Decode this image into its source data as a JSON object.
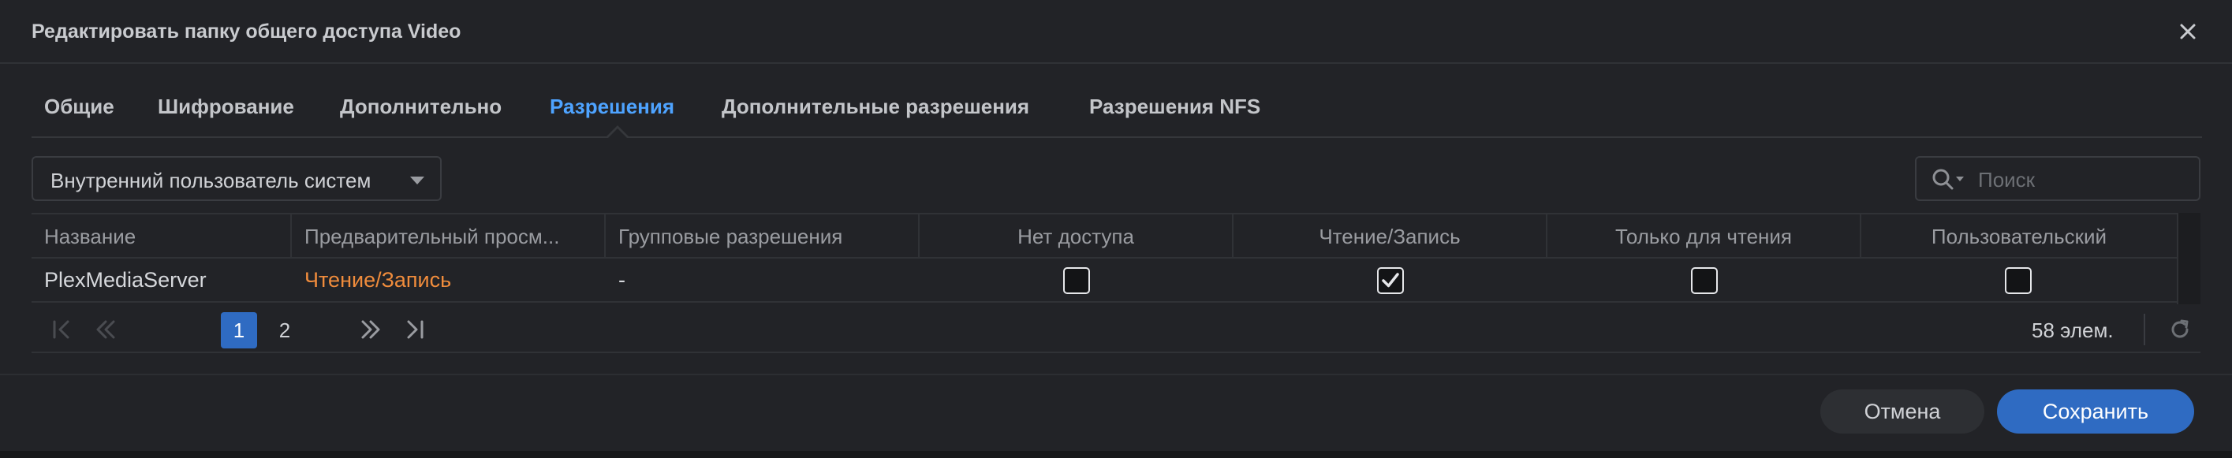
{
  "dialog": {
    "title": "Редактировать папку общего доступа Video"
  },
  "tabs": [
    {
      "label": "Общие",
      "active": false
    },
    {
      "label": "Шифрование",
      "active": false
    },
    {
      "label": "Дополнительно",
      "active": false
    },
    {
      "label": "Разрешения",
      "active": true
    },
    {
      "label": "Дополнительные разрешения",
      "active": false
    },
    {
      "label": "Разрешения NFS",
      "active": false
    }
  ],
  "toolbar": {
    "user_type_select": "Внутренний пользователь систем",
    "search_placeholder": "Поиск"
  },
  "table": {
    "columns": [
      "Название",
      "Предварительный просм...",
      "Групповые разрешения",
      "Нет доступа",
      "Чтение/Запись",
      "Только для чтения",
      "Пользовательский"
    ],
    "rows": [
      {
        "name": "PlexMediaServer",
        "preview": "Чтение/Запись",
        "group_permissions": "-",
        "no_access": false,
        "read_write": true,
        "read_only": false,
        "custom": false
      }
    ]
  },
  "pager": {
    "pages": [
      "1",
      "2"
    ],
    "current_page": "1",
    "count": "58 элем."
  },
  "footer": {
    "cancel_label": "Отмена",
    "save_label": "Сохранить"
  },
  "colors": {
    "accent": "#4ea3ff",
    "primary_button": "#2f6bc2",
    "preview_orange": "#f08c3c",
    "background": "#222327"
  },
  "icons": [
    "close-icon",
    "caret-down-icon",
    "search-icon",
    "first-page-icon",
    "prev-page-icon",
    "next-page-icon",
    "last-page-icon",
    "refresh-icon",
    "checkmark-icon"
  ]
}
